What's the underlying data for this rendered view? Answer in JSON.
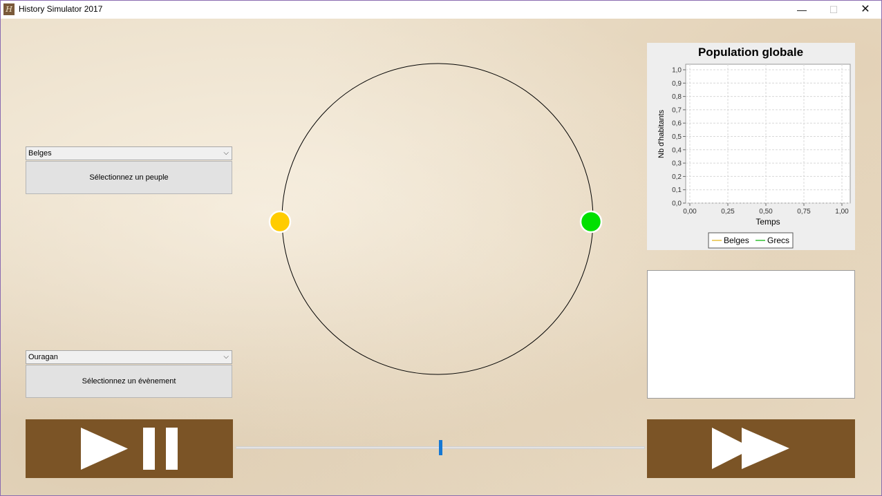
{
  "window": {
    "title": "History Simulator 2017",
    "icon_letter": "H"
  },
  "controls": {
    "people_combo": {
      "value": "Belges"
    },
    "people_button": {
      "label": "Sélectionnez un peuple"
    },
    "event_combo": {
      "value": "Ouragan"
    },
    "event_button": {
      "label": "Sélectionnez un évènement"
    }
  },
  "world": {
    "nodes": [
      {
        "name": "Belges",
        "color": "#ffcc00"
      },
      {
        "name": "Grecs",
        "color": "#00e000"
      }
    ]
  },
  "slider": {
    "value_fraction": 0.5
  },
  "colors": {
    "control_brown": "#7b5426",
    "accent_blue": "#1478d4"
  },
  "chart_data": {
    "type": "line",
    "title": "Population globale",
    "xlabel": "Temps",
    "ylabel": "Nb d'habitants",
    "xlim": [
      0,
      1
    ],
    "ylim": [
      0,
      1
    ],
    "x_ticks": [
      "0,00",
      "0,25",
      "0,50",
      "0,75",
      "1,00"
    ],
    "y_ticks": [
      "0,0",
      "0,1",
      "0,2",
      "0,3",
      "0,4",
      "0,5",
      "0,6",
      "0,7",
      "0,8",
      "0,9",
      "1,0"
    ],
    "grid": true,
    "legend_position": "bottom",
    "series": [
      {
        "name": "Belges",
        "color": "#e8c040",
        "x": [],
        "values": []
      },
      {
        "name": "Grecs",
        "color": "#30c030",
        "x": [],
        "values": []
      }
    ]
  }
}
